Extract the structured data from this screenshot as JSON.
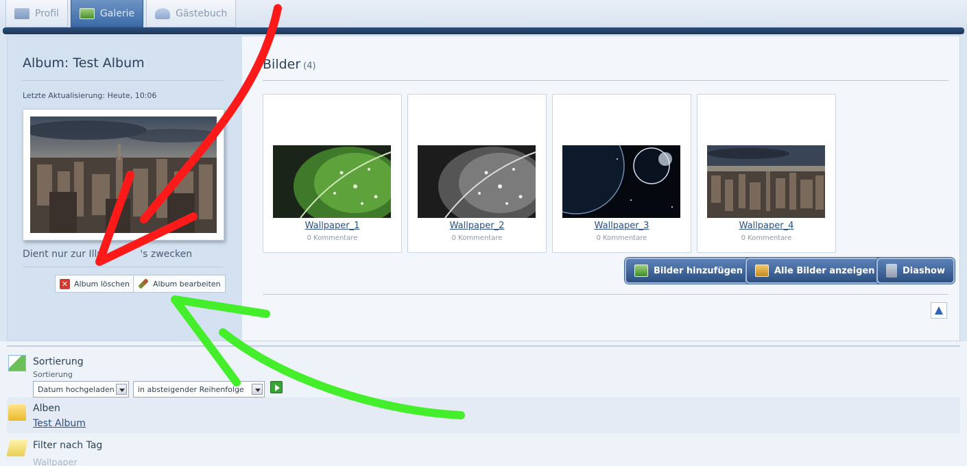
{
  "tabs": [
    {
      "label": "Profil",
      "icon": "profile-icon",
      "active": false
    },
    {
      "label": "Galerie",
      "icon": "gallery-icon",
      "active": true
    },
    {
      "label": "Gästebuch",
      "icon": "guestbook-icon",
      "active": false
    }
  ],
  "album": {
    "title": "Album: Test Album",
    "last_update": "Letzte Aktualisierung: Heute, 10:06",
    "description": "Dient nur zur Illu",
    "description_end": "'s zwecken",
    "delete_label": "Album löschen",
    "edit_label": "Album bearbeiten"
  },
  "images": {
    "heading": "Bilder",
    "count": "(4)",
    "items": [
      {
        "title": "Wallpaper_1",
        "comments": "0 Kommentare"
      },
      {
        "title": "Wallpaper_2",
        "comments": "0 Kommentare"
      },
      {
        "title": "Wallpaper_3",
        "comments": "0 Kommentare"
      },
      {
        "title": "Wallpaper_4",
        "comments": "0 Kommentare"
      }
    ],
    "add_label": "Bilder hinzufügen",
    "all_label": "Alle Bilder anzeigen",
    "slideshow_label": "Diashow"
  },
  "sort": {
    "heading": "Sortierung",
    "sublabel": "Sortierung",
    "field_value": "Datum hochgeladen",
    "order_value": "in absteigender Reihenfolge"
  },
  "albums": {
    "heading": "Alben",
    "link": "Test Album"
  },
  "filter": {
    "heading": "Filter nach Tag",
    "tag": "Wallpaper"
  },
  "colors": {
    "accent": "#2c4f80",
    "annotation_red": "#ff1a1a",
    "annotation_green": "#44ee2a"
  }
}
